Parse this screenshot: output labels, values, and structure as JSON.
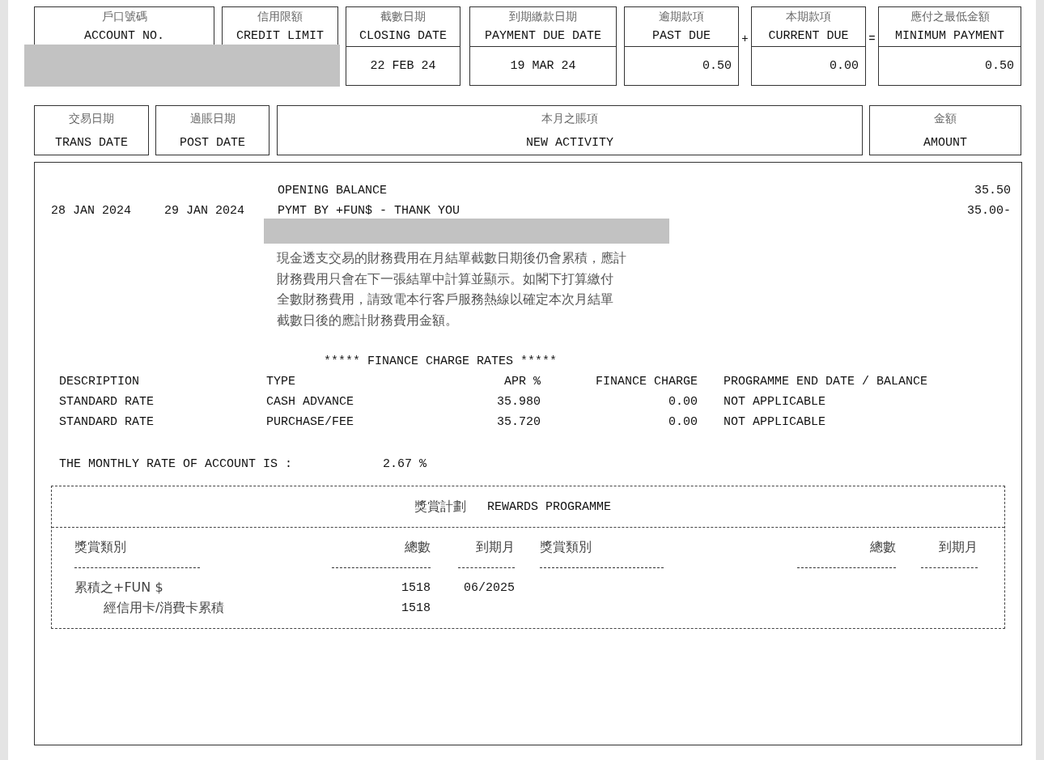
{
  "summary": [
    {
      "label_zh": "戶口號碼",
      "label_en": "ACCOUNT NO."
    },
    {
      "label_zh": "信用限額",
      "label_en": "CREDIT LIMIT"
    },
    {
      "label_zh": "截數日期",
      "label_en": "CLOSING DATE",
      "value": "22 FEB 24"
    },
    {
      "label_zh": "到期繳款日期",
      "label_en": "PAYMENT DUE DATE",
      "value": "19 MAR 24"
    },
    {
      "label_zh": "逾期款項",
      "label_en": "PAST DUE",
      "value": "0.50"
    },
    {
      "operator": "+",
      "label_zh": "本期款項",
      "label_en": "CURRENT DUE",
      "value": "0.00"
    },
    {
      "operator": "=",
      "label_zh": "應付之最低金額",
      "label_en": "MINIMUM PAYMENT",
      "value": "0.50"
    }
  ],
  "activity_header": [
    {
      "label_zh": "交易日期",
      "label_en": "TRANS DATE"
    },
    {
      "label_zh": "過賬日期",
      "label_en": "POST DATE"
    },
    {
      "label_zh": "本月之賬項",
      "label_en": "NEW ACTIVITY"
    },
    {
      "label_zh": "金額",
      "label_en": "AMOUNT"
    }
  ],
  "activity": {
    "lines": [
      {
        "description": "OPENING BALANCE",
        "amount": "35.50"
      },
      {
        "trans_date": "28 JAN 2024",
        "post_date": "29 JAN 2024",
        "description": "PYMT BY +FUN$ - THANK YOU",
        "amount": "35.00-"
      }
    ],
    "note_lines": [
      "現金透支交易的財務費用在月結單截數日期後仍會累積，應計",
      "財務費用只會在下一張結單中計算並顯示。如閣下打算繳付",
      "全數財務費用，請致電本行客戶服務熱線以確定本次月結單",
      "截數日後的應計財務費用金額。"
    ]
  },
  "finance_charge": {
    "title": "***** FINANCE CHARGE RATES *****",
    "columns": [
      "DESCRIPTION",
      "TYPE",
      "APR %",
      "FINANCE CHARGE",
      "PROGRAMME END DATE / BALANCE"
    ],
    "rows": [
      [
        "STANDARD RATE",
        "CASH ADVANCE",
        "35.980",
        "0.00",
        "NOT APPLICABLE"
      ],
      [
        "STANDARD RATE",
        "PURCHASE/FEE",
        "35.720",
        "0.00",
        "NOT APPLICABLE"
      ]
    ],
    "monthly_rate_label": "THE MONTHLY RATE OF ACCOUNT IS :",
    "monthly_rate_value": "2.67 %"
  },
  "rewards": {
    "title_zh": "獎賞計劃",
    "title_en": "REWARDS PROGRAMME",
    "columns": [
      "獎賞類別",
      "總數",
      "到期月",
      "獎賞類別",
      "總數",
      "到期月"
    ],
    "rows": [
      {
        "category": "累積之+FUN $",
        "total": "1518",
        "expiry": "06/2025",
        "children": [
          {
            "category": "經信用卡/消費卡累積",
            "total": "1518"
          }
        ]
      }
    ]
  }
}
